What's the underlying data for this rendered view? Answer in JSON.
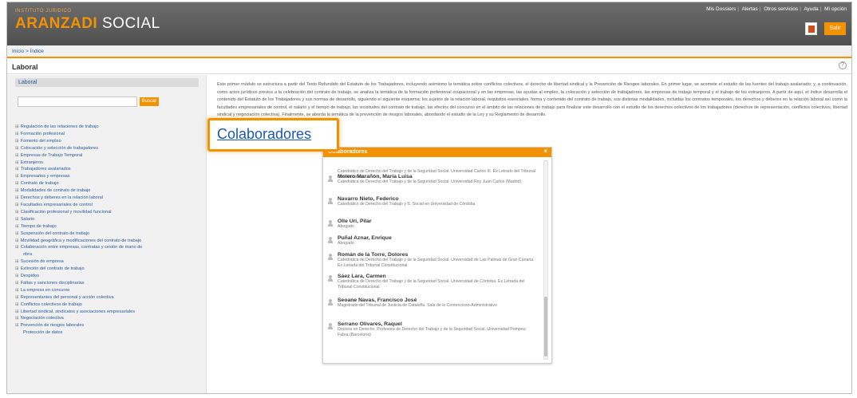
{
  "header": {
    "brand_top": "INSTITUTO JURIDICO",
    "brand_primary": "ARANZADI",
    "brand_secondary": "SOCIAL",
    "top_links": [
      "Mis Dossiers",
      "Alertas",
      "Otros servicios",
      "Ayuda",
      "Mi opción"
    ],
    "exit_label": "Salir"
  },
  "breadcrumb": "Inicio > Índice",
  "page_title": "Laboral",
  "sidebar": {
    "heading": "Laboral",
    "search_button": "Buscar",
    "tree": [
      "Regulación de las relaciones de trabajo",
      "Formación profesional",
      "Fomento del empleo",
      "Colocación y selección de trabajadores",
      "Empresas de Trabajo Temporal",
      "Extranjeros",
      "Trabajadores asalariados",
      "Empresarios y empresas",
      "Contrato de trabajo",
      "Modalidades de contrato de trabajo",
      "Derechos y deberes en la relación laboral",
      "Facultades empresariales de control",
      "Clasificación profesional y movilidad funcional",
      "Salario",
      "Tiempo de trabajo",
      "Suspensión del contrato de trabajo",
      "Movilidad geográfica y modificaciones del contrato de trabajo",
      "Colaboración entre empresas, contratas y cesión de mano de",
      "obra",
      "Sucesión de empresa",
      "Extinción del contrato de trabajo",
      "Despidos",
      "Faltas y sanciones disciplinarias",
      "La empresa en concurso",
      "Representantes del personal y acción colectiva",
      "Conflictos colectivos de trabajo",
      "Libertad sindical, sindicatos y asociaciones empresariales",
      "Negociación colectiva",
      "Prevención de riesgos laborales",
      "Protección de datos"
    ]
  },
  "main_text": "Este primer módulo se estructura a partir del Texto Refundido del Estatuto de los Trabajadores, incluyendo asimismo la temática sobre conflictos colectivos, el derecho de libertad sindical y la Prevención de Riesgos laborales. En primer lugar, se acomete el estudio de las fuentes del trabajo asalariado; y, a continuación, como actos jurídicos previos a la celebración del contrato de trabajo, se analiza la temática de la formación profesional ocupacional y en las empresas, las ayudas al empleo, la colocación y selección de trabajadores, las empresas de trabajo temporal y el trabajo de los extranjeros. A partir de aquí, el índice desarrolla el contenido del Estatuto de los Trabajadores y sus normas de desarrollo, siguiendo el siguiente esquema: los sujetos de la relación laboral, requisitos esenciales, forma y contenido del contrato de trabajo, sus distintas modalidades, incluidas los contratos temporales, los derechos y deberes en la relación laboral así como la facultades empresariales de control, el salario y el tiempo de trabajo, las vicisitudes del contrato de trabajo, las efectos del concurso en el ámbito de las relaciones de trabajo para finalizar este desarrollo con el estudio de los derechos colectivos de los trabajadores (derechos de representación, conflictos colectivos, libertad sindical y negociación colectiva). Finalmente, se aborda la temática de la prevención de riesgos laborales, abordando el estudio de la Ley y su Reglamento de desarrollo.",
  "callout_link": "Colaboradores",
  "popup": {
    "title": "Colaboradores",
    "close": "×",
    "partial_first": "Catedrático de Derecho del Trabajo y de la Seguridad Social. Universidad Carlos III. Ex Letrado del Tribunal Constitucional",
    "people": [
      {
        "name": "Molero Marañón, María Luisa",
        "desc": "Catedrática de Derecho del Trabajo y de la Seguridad Social. Universidad Rey Juan Carlos (Madrid)"
      },
      {
        "name": "Navarro Nieto, Federico",
        "desc": "Catedrático de Derecho del Trabajo y S. Social en Universidad de Córdoba"
      },
      {
        "name": "Olle Uri, Pilar",
        "desc": "Abogado"
      },
      {
        "name": "Puñal Aznar, Enrique",
        "desc": "Abogado"
      },
      {
        "name": "Román de la Torre, Dolores",
        "desc": "Catedrática de Derecho del Trabajo y de la Seguridad Social. Universidad de Las Palmas de Gran Canaria. Ex Letrada del Tribunal Constitucional"
      },
      {
        "name": "Sáez Lara, Carmen",
        "desc": "Catedrática de Derecho del Trabajo y de la Seguridad Social. Universidad de Córdoba. Ex Letrada del Tribunal Constitucional"
      },
      {
        "name": "Seoane Navas, Francisco José",
        "desc": "Magistrado del Tribunal de Justicia de Cataluña. Sala de lo Contencioso-Administrativo"
      },
      {
        "name": "Serrano Olivares, Raquel",
        "desc": "Doctora en Derecho. Profesora de Derecho del Trabajo y de la Seguridad Social. Universidad Pompeu Fabra (Barcelona)"
      }
    ]
  },
  "colors": {
    "accent": "#f39200",
    "link": "#2b5a9a",
    "header": "#5a5a5a"
  },
  "icons": {
    "pdf": "pdf-icon",
    "help": "help-icon",
    "person": "user-icon",
    "tree_expand": "plus-icon"
  }
}
